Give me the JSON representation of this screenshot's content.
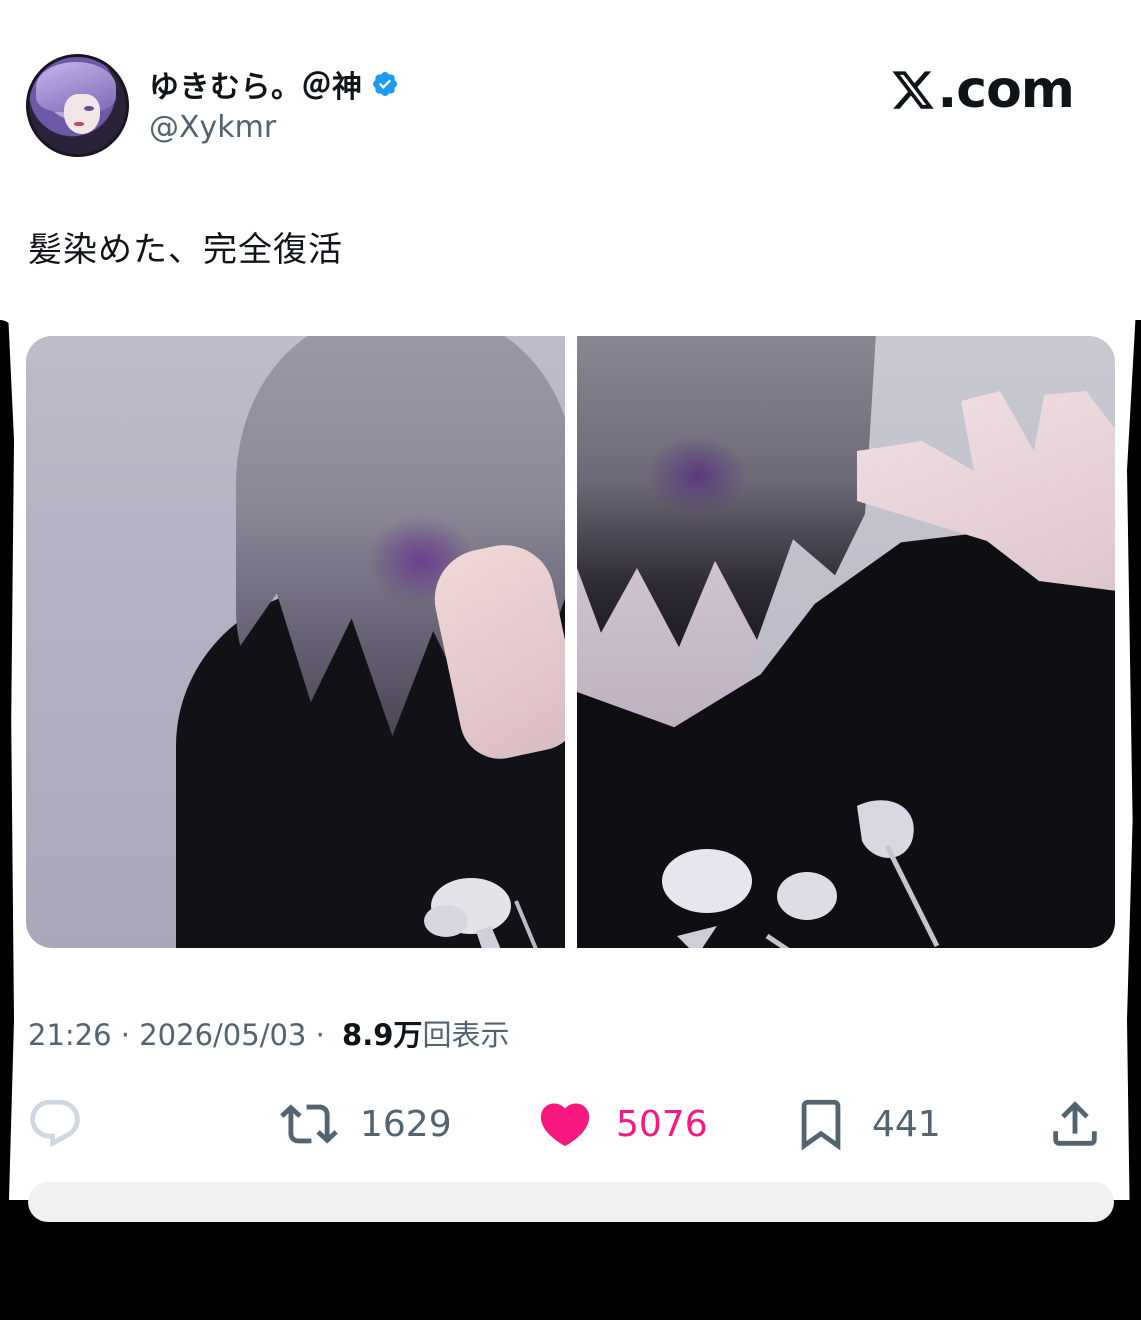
{
  "brand": {
    "text": ".com"
  },
  "user": {
    "display_name": "ゆきむら。＠神",
    "handle": "@Xykmr"
  },
  "tweet": {
    "text": "髪染めた、完全復活"
  },
  "meta": {
    "time": "21:26",
    "sep1": " · ",
    "date": "2026/05/03",
    "sep2": " · ",
    "views_number": "8.9",
    "views_unit": "万",
    "views_label": "回表示"
  },
  "actions": {
    "reply_count": "",
    "retweet_count": "1629",
    "like_count": "5076",
    "bookmark_count": "441"
  },
  "colors": {
    "like": "#f91880",
    "verified": "#1d9bf0",
    "secondary_text": "#536471",
    "primary_text": "#0f1419"
  },
  "icons": {
    "verified": "verified-badge-icon",
    "reply": "reply-icon",
    "retweet": "retweet-icon",
    "like": "heart-icon",
    "bookmark": "bookmark-icon",
    "share": "share-icon",
    "brand": "x-logo-icon"
  }
}
